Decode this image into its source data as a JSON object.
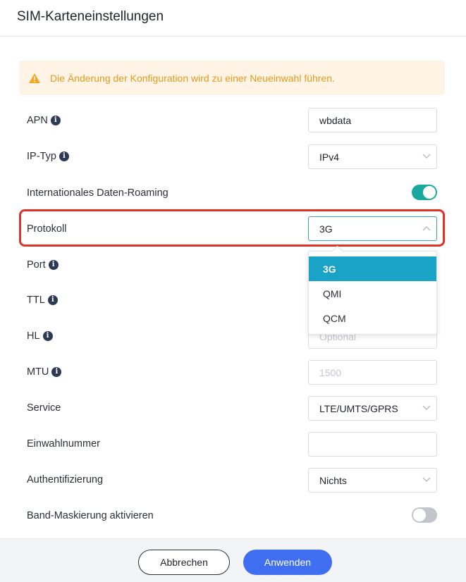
{
  "dialog": {
    "title": "SIM-Karteneinstellungen"
  },
  "notice": {
    "icon": "warning-icon",
    "text": "Die Änderung der Konfiguration wird zu einer Neueinwahl führen.",
    "color": "#e39a1f"
  },
  "form": {
    "apn": {
      "label": "APN",
      "value": "wbdata"
    },
    "ip_type": {
      "label": "IP-Typ",
      "value": "IPv4"
    },
    "roaming": {
      "label": "Internationales Daten-Roaming",
      "enabled": true
    },
    "protocol": {
      "label": "Protokoll",
      "value": "3G",
      "options": [
        "3G",
        "QMI",
        "QCM"
      ],
      "selected_index": 0
    },
    "port": {
      "label": "Port"
    },
    "ttl": {
      "label": "TTL"
    },
    "hl": {
      "label": "HL",
      "placeholder": "Optional"
    },
    "mtu": {
      "label": "MTU",
      "placeholder": "1500"
    },
    "service": {
      "label": "Service",
      "value": "LTE/UMTS/GPRS"
    },
    "dial_number": {
      "label": "Einwahlnummer",
      "value": ""
    },
    "auth": {
      "label": "Authentifizierung",
      "value": "Nichts"
    },
    "band_mask": {
      "label": "Band-Maskierung aktivieren",
      "enabled": false
    }
  },
  "footer": {
    "cancel_label": "Abbrechen",
    "apply_label": "Anwenden"
  },
  "colors": {
    "accent": "#3f6ff0",
    "toggle_on": "#18a89e",
    "selected_option": "#19a3c7",
    "highlight": "#e0322a"
  }
}
